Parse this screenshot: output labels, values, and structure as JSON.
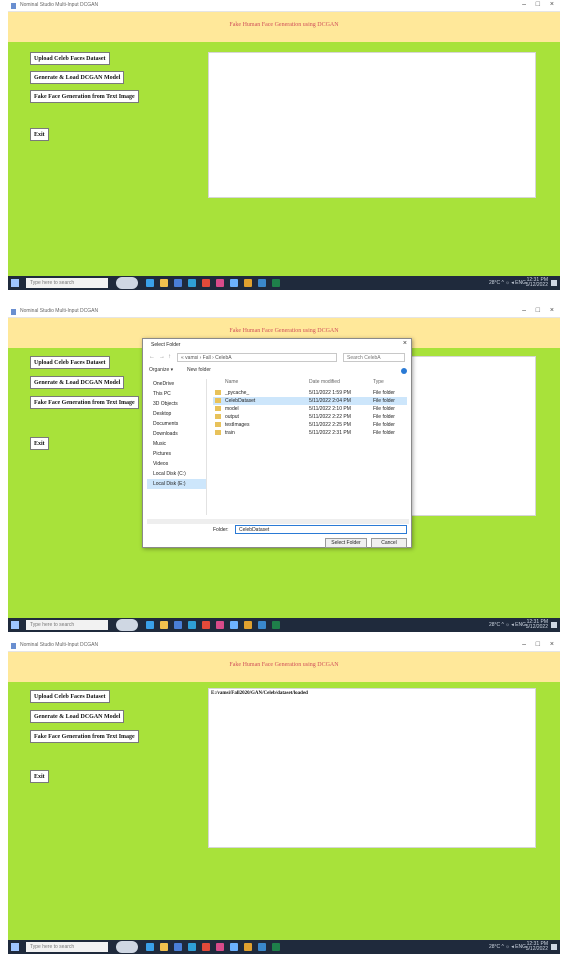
{
  "app": {
    "window_title": "Nominal Studio Multi-Input DCGAN",
    "header_title": "Fake Human Face Generation using DCGAN",
    "window_controls": {
      "minimize": "–",
      "maximize": "□",
      "close": "×"
    }
  },
  "buttons": {
    "upload": "Upload Celeb Faces Dataset",
    "generate": "Generate & Load DCGAN Model",
    "fake_face": "Fake Face Generation from Text Image",
    "exit": "Exit"
  },
  "output": {
    "panel3_text": "E:/vamsi/Fall2020/GAN/Celeb/dataset/loaded"
  },
  "taskbar": {
    "search_placeholder": "Type here to search",
    "tray_text": "28°C  ^  ☼ ◂ ENG",
    "clock_time": "12:31 PM",
    "clock_date": "5/12/2022"
  },
  "dialog": {
    "title": "Select Folder",
    "path": "« vamsi › Fall › CelebA",
    "search_placeholder": "Search CelebA",
    "toolbar_organize": "Organize ▾",
    "toolbar_newfolder": "New folder",
    "nav_items": [
      {
        "label": "OneDrive"
      },
      {
        "label": "This PC"
      },
      {
        "label": "3D Objects"
      },
      {
        "label": "Desktop"
      },
      {
        "label": "Documents"
      },
      {
        "label": "Downloads"
      },
      {
        "label": "Music"
      },
      {
        "label": "Pictures"
      },
      {
        "label": "Videos"
      },
      {
        "label": "Local Disk (C:)"
      },
      {
        "label": "Local Disk (E:)"
      }
    ],
    "columns": {
      "name": "Name",
      "date": "Date modified",
      "type": "Type"
    },
    "files": [
      {
        "name": "_pycache_",
        "date": "5/11/2022 1:59 PM",
        "type": "File folder"
      },
      {
        "name": "CelebDataset",
        "date": "5/11/2022 2:04 PM",
        "type": "File folder"
      },
      {
        "name": "model",
        "date": "5/11/2022 2:10 PM",
        "type": "File folder"
      },
      {
        "name": "output",
        "date": "5/11/2022 2:22 PM",
        "type": "File folder"
      },
      {
        "name": "testImages",
        "date": "5/11/2022 2:25 PM",
        "type": "File folder"
      },
      {
        "name": "train",
        "date": "5/11/2022 2:31 PM",
        "type": "File folder"
      }
    ],
    "filename_label": "Folder:",
    "filename_value": "CelebDataset",
    "select_button": "Select Folder",
    "cancel_button": "Cancel"
  }
}
